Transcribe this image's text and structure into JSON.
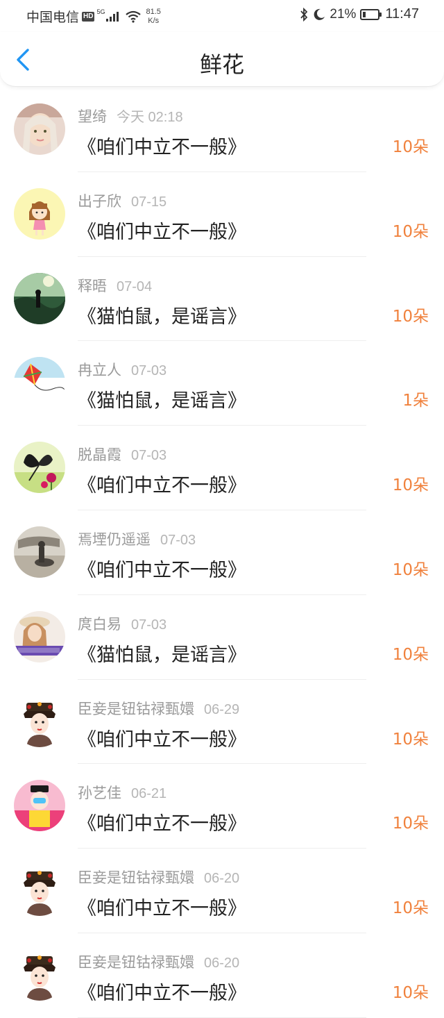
{
  "status_bar": {
    "carrier": "中国电信",
    "hd": "HD",
    "network": "5G",
    "speed_value": "81.5",
    "speed_unit": "K/s",
    "battery_pct": "21%",
    "time": "11:47"
  },
  "header": {
    "title": "鲜花"
  },
  "colors": {
    "accent": "#2196f3",
    "count": "#f0813c"
  },
  "rows": [
    {
      "name": "望绮",
      "date": "今天 02:18",
      "title": "《咱们中立不一般》",
      "count": "10朵",
      "avatar": "girl-photo"
    },
    {
      "name": "出子欣",
      "date": "07-15",
      "title": "《咱们中立不一般》",
      "count": "10朵",
      "avatar": "cartoon-girl"
    },
    {
      "name": "释晤",
      "date": "07-04",
      "title": "《猫怕鼠，是谣言》",
      "count": "10朵",
      "avatar": "green-landscape"
    },
    {
      "name": "冉立人",
      "date": "07-03",
      "title": "《猫怕鼠，是谣言》",
      "count": "1朵",
      "avatar": "kite"
    },
    {
      "name": "脱晶霞",
      "date": "07-03",
      "title": "《咱们中立不一般》",
      "count": "10朵",
      "avatar": "butterfly-flower"
    },
    {
      "name": "焉堙仍遥遥",
      "date": "07-03",
      "title": "《咱们中立不一般》",
      "count": "10朵",
      "avatar": "sepia-photo"
    },
    {
      "name": "庹白易",
      "date": "07-03",
      "title": "《猫怕鼠，是谣言》",
      "count": "10朵",
      "avatar": "girl-hat"
    },
    {
      "name": "臣妾是钮钴禄甄嬛",
      "date": "06-29",
      "title": "《咱们中立不一般》",
      "count": "10朵",
      "avatar": "empress-cartoon"
    },
    {
      "name": "孙艺佳",
      "date": "06-21",
      "title": "《咱们中立不一般》",
      "count": "10朵",
      "avatar": "pink-cartoon"
    },
    {
      "name": "臣妾是钮钴禄甄嬛",
      "date": "06-20",
      "title": "《咱们中立不一般》",
      "count": "10朵",
      "avatar": "empress-cartoon"
    },
    {
      "name": "臣妾是钮钴禄甄嬛",
      "date": "06-20",
      "title": "《咱们中立不一般》",
      "count": "10朵",
      "avatar": "empress-cartoon"
    }
  ]
}
